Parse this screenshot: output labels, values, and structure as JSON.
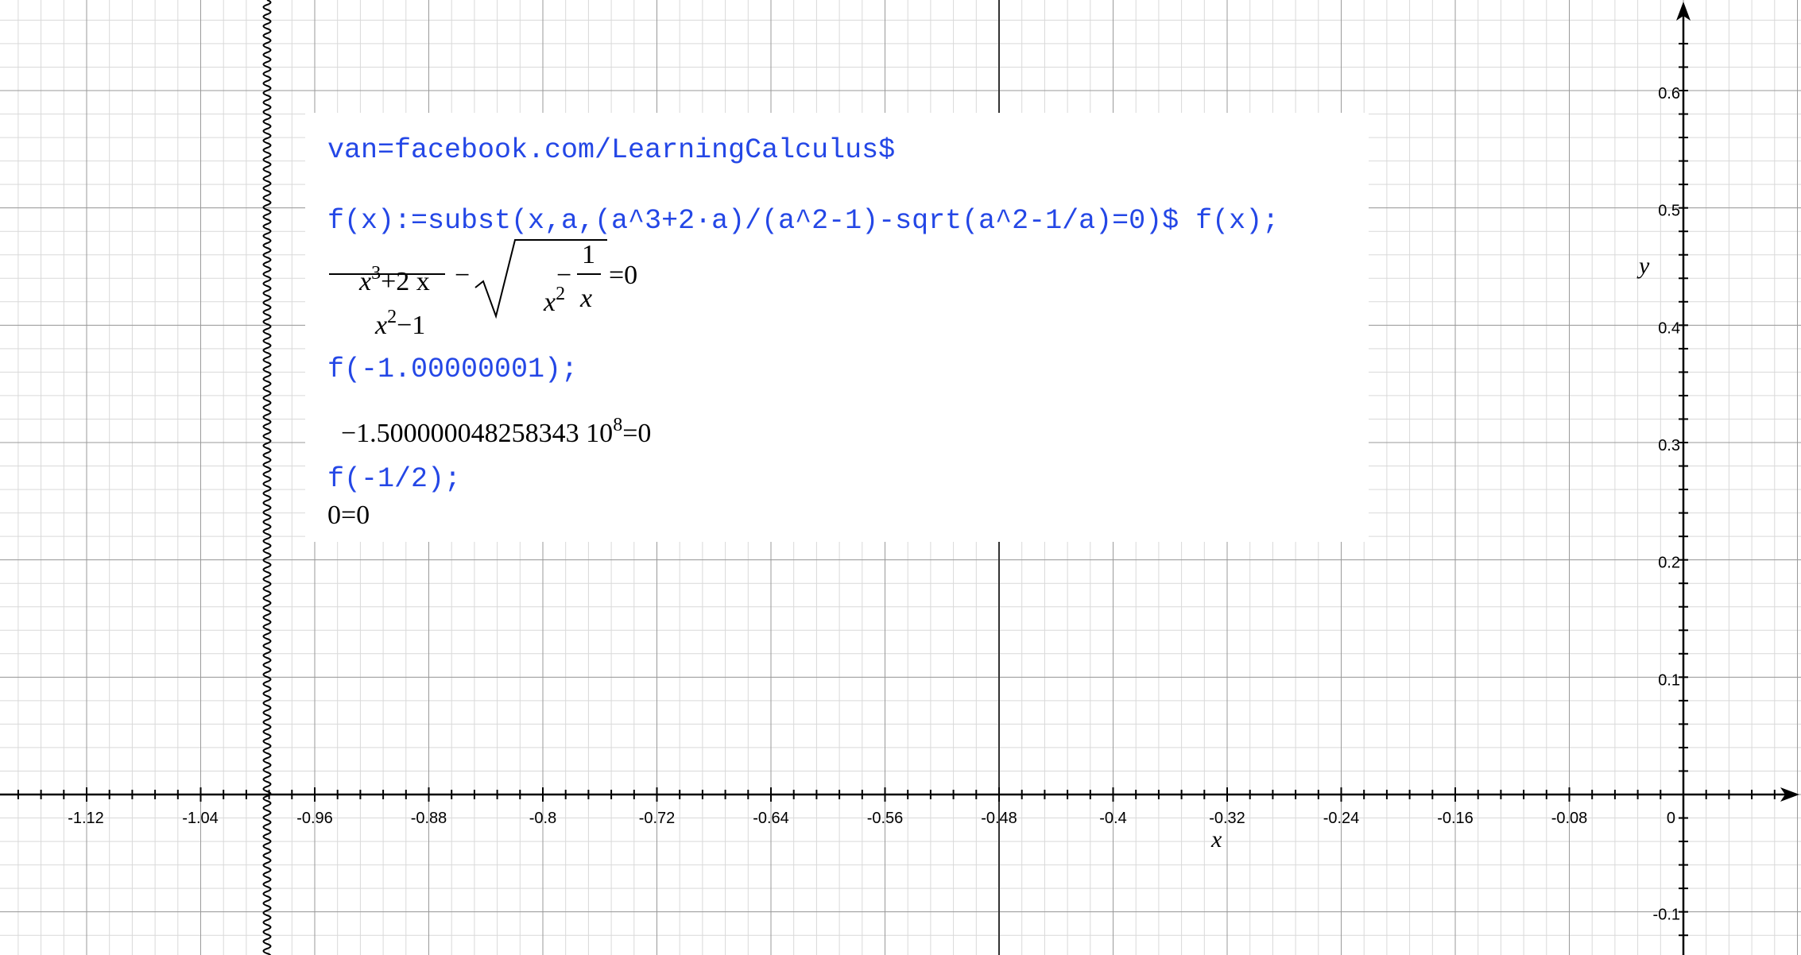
{
  "graph": {
    "x_axis_label": "x",
    "y_axis_label": "y",
    "x_ticks": [
      "-1.12",
      "-1.04",
      "-0.96",
      "-0.88",
      "-0.8",
      "-0.72",
      "-0.64",
      "-0.56",
      "-0.48",
      "-0.4",
      "-0.32",
      "-0.24",
      "-0.16",
      "-0.08",
      "0"
    ],
    "y_ticks": [
      "0.6",
      "0.5",
      "0.4",
      "0.3",
      "0.2",
      "0.1",
      "-0.1"
    ],
    "x_range": [
      -1.1764,
      0.0752
    ],
    "y_range": [
      -0.1386,
      0.6762
    ],
    "axis_break": "wavy vertical break between -1.04 and -0.96",
    "colors": {
      "grid_minor": "#d9d9d9",
      "grid_major": "#9a9a9a",
      "axis": "#000000",
      "input_text": "#2447e6",
      "output_text": "#000000"
    }
  },
  "worksheet": {
    "line1": "van=facebook.com/LearningCalculus$",
    "line2": "f(x):=subst(x,a,(a^3+2·a)/(a^2-1)-sqrt(a^2-1/a)=0)$ f(x);",
    "out1": {
      "num_base": "x",
      "num_exp": "3",
      "num_rest": "+2 x",
      "den_base": "x",
      "den_exp": "2",
      "den_rest": "−1",
      "minus": "−",
      "rad_base": "x",
      "rad_exp": "2",
      "rad_minus": "−",
      "inner_num": "1",
      "inner_den": "x",
      "equals": "=0"
    },
    "line3": "f(-1.00000001);",
    "out2_mantissa": "−1.500000048258343 10",
    "out2_exp": "8",
    "out2_equals": "=0",
    "line4": "f(-1/2);",
    "out3": "0=0"
  }
}
